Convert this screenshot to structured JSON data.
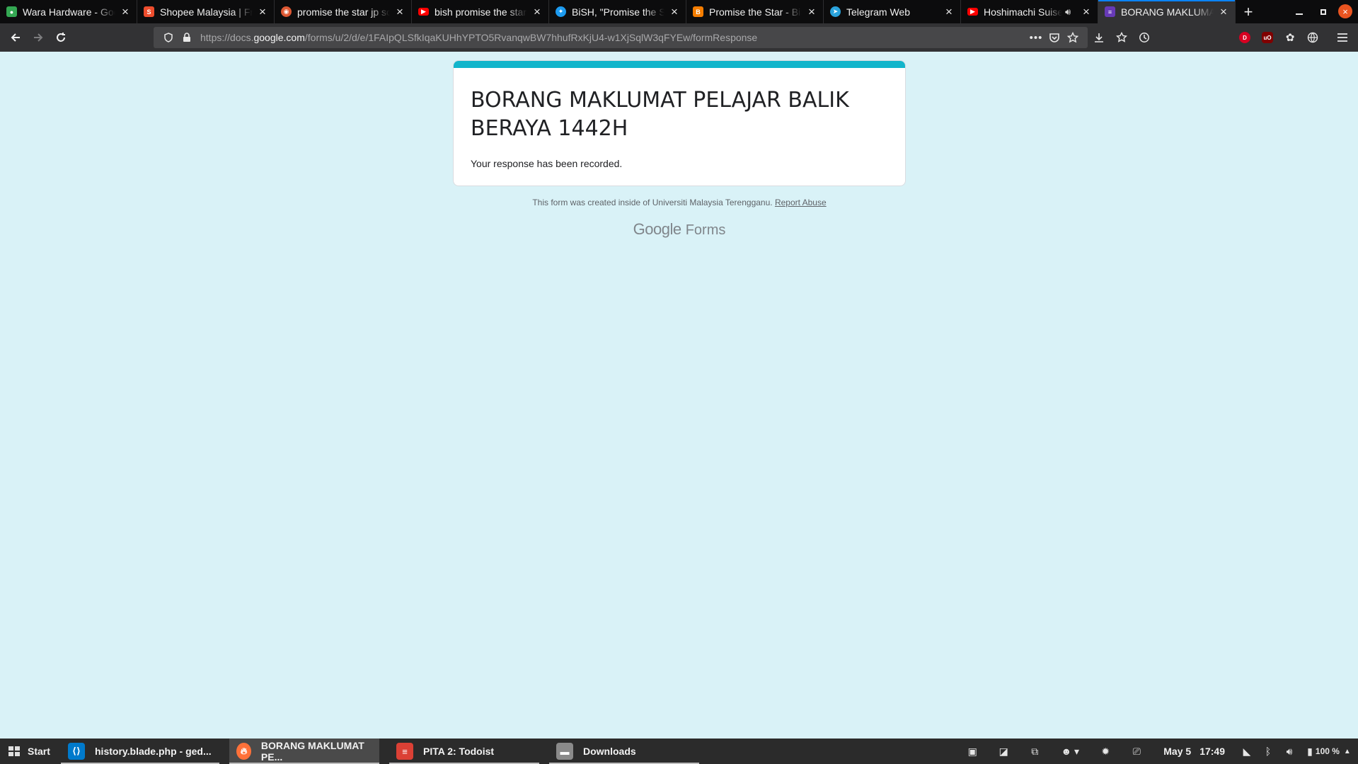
{
  "tabs": [
    {
      "title": "Wara Hardware - Google Maps",
      "favicon": "maps-pin-icon",
      "color": "#34a853"
    },
    {
      "title": "Shopee Malaysia | Free Shipping",
      "favicon": "shopee-bag-icon",
      "color": "#ee4d2d"
    },
    {
      "title": "promise the star jp song",
      "favicon": "search-engine-icon",
      "color": "#de5833"
    },
    {
      "title": "bish promise the star - YouTube",
      "favicon": "youtube-icon",
      "color": "#ff0000"
    },
    {
      "title": "BiSH, \"Promise the Star\"",
      "favicon": "bird-icon",
      "color": "#1d9bf0"
    },
    {
      "title": "Promise the Star - BiSH",
      "favicon": "blogger-icon",
      "color": "#f57d00"
    },
    {
      "title": "Telegram Web",
      "favicon": "telegram-icon",
      "color": "#2aa3dc"
    },
    {
      "title": "Hoshimachi Suisei",
      "favicon": "youtube-icon",
      "color": "#ff0000",
      "playing_audio": true
    },
    {
      "title": "BORANG MAKLUMAT PELAJAR",
      "favicon": "google-forms-icon",
      "color": "#673ab7",
      "active": true
    }
  ],
  "address_bar": {
    "url_prefix": "https://docs.",
    "url_host": "google.com",
    "url_path": "/forms/u/2/d/e/1FAIpQLSfkIqaKUHhYPTO5RvanqwBW7hhufRxKjU4-w1XjSqlW3qFYEw/formResponse"
  },
  "extensions": [
    {
      "label": "D",
      "color": "#d70022"
    },
    {
      "label": "uO",
      "color": "#800000"
    }
  ],
  "form": {
    "title": "BORANG MAKLUMAT PELAJAR BALIK BERAYA 1442H",
    "message": "Your response has been recorded.",
    "footer_text": "This form was created inside of Universiti Malaysia Terengganu.",
    "report_link": "Report Abuse",
    "brand_google": "Google",
    "brand_forms": "Forms",
    "accent_color": "#12b5cb"
  },
  "taskbar": {
    "start_label": "Start",
    "tasks": [
      {
        "label": "history.blade.php - ged...",
        "icon": "vscode-icon",
        "color": "#007acc"
      },
      {
        "label": "BORANG MAKLUMAT PE...",
        "icon": "firefox-icon",
        "color": "#ff7139",
        "active": true
      },
      {
        "label": "PITA 2: Todoist",
        "icon": "todoist-icon",
        "color": "#db4035"
      },
      {
        "label": "Downloads",
        "icon": "folder-icon",
        "color": "#8a8a8a"
      }
    ],
    "date": "May 5",
    "time": "17:49",
    "battery": "100 %"
  }
}
